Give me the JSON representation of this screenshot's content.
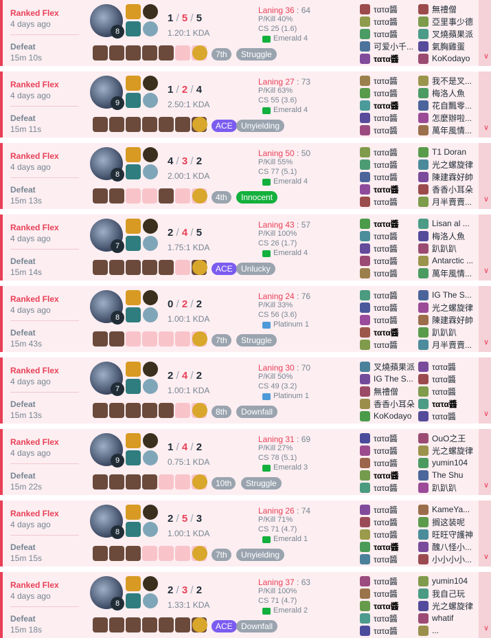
{
  "colors": {
    "loss_accent": "#e84057",
    "muted": "#758592",
    "tag_gray": "#9aa4af",
    "ace": "#7b5cf0",
    "good": "#13b03d",
    "emerald": "#13b03d",
    "platinum": "#4e9ad9"
  },
  "matches": [
    {
      "mode": "Ranked Flex",
      "ago": "4 days ago",
      "result": "Defeat",
      "duration": "15m 10s",
      "level": "8",
      "kda": {
        "k": "1",
        "d": "5",
        "a": "5"
      },
      "ratio": "1.20:1 KDA",
      "position": "7th",
      "position_ace": false,
      "tag": "Struggle",
      "tag_positive": false,
      "laning": "Laning 36",
      "laning_vs": "64",
      "pkill": "P/Kill 40%",
      "cs": "CS 25 (1.6)",
      "tier": "Emerald 4",
      "tier_kind": "emerald",
      "items": [
        "f",
        "f",
        "f",
        "f",
        "f",
        "e",
        "e"
      ],
      "team1": [
        "τατα醬",
        "τατα醬",
        "τατα醬",
        "可爱小千...",
        "τατα醬"
      ],
      "team2": [
        "無禮僧",
        "亞里事少德",
        "叉燒蘋果派",
        "氣胸雞蛋",
        "KoKodayo"
      ],
      "me_side": 1,
      "me_index": 4
    },
    {
      "mode": "Ranked Flex",
      "ago": "4 days ago",
      "result": "Defeat",
      "duration": "15m 11s",
      "level": "9",
      "kda": {
        "k": "1",
        "d": "2",
        "a": "4"
      },
      "ratio": "2.50:1 KDA",
      "position": "ACE",
      "position_ace": true,
      "tag": "Unyielding",
      "tag_positive": false,
      "laning": "Laning 27",
      "laning_vs": "73",
      "pkill": "P/Kill 63%",
      "cs": "CS 55 (3.6)",
      "tier": "Emerald 4",
      "tier_kind": "emerald",
      "items": [
        "f",
        "f",
        "f",
        "f",
        "f",
        "f",
        "f"
      ],
      "team1": [
        "τατα醬",
        "τατα醬",
        "τατα醬",
        "τατα醬",
        "τατα醬"
      ],
      "team2": [
        "我不是叉...",
        "梅洛人魚",
        "花自飄零...",
        "怎麼辦啦...",
        "萬年風情..."
      ],
      "me_side": 1,
      "me_index": 2
    },
    {
      "mode": "Ranked Flex",
      "ago": "4 days ago",
      "result": "Defeat",
      "duration": "15m 13s",
      "level": "8",
      "kda": {
        "k": "4",
        "d": "3",
        "a": "2"
      },
      "ratio": "2.00:1 KDA",
      "position": "4th",
      "position_ace": false,
      "tag": "Innocent",
      "tag_positive": true,
      "laning": "Laning 50",
      "laning_vs": "50",
      "pkill": "P/Kill 55%",
      "cs": "CS 77 (5.1)",
      "tier": "Emerald 4",
      "tier_kind": "emerald",
      "items": [
        "f",
        "f",
        "e",
        "e",
        "f",
        "e",
        "e"
      ],
      "team1": [
        "τατα醬",
        "τατα醬",
        "τατα醬",
        "τατα醬",
        "τατα醬"
      ],
      "team2": [
        "T1 Doran",
        "光之螺旋律",
        "陳建霖好帥",
        "香香小耳朵",
        "月半賣賣..."
      ],
      "me_side": 1,
      "me_index": 3
    },
    {
      "mode": "Ranked Flex",
      "ago": "4 days ago",
      "result": "Defeat",
      "duration": "15m 14s",
      "level": "7",
      "kda": {
        "k": "2",
        "d": "4",
        "a": "5"
      },
      "ratio": "1.75:1 KDA",
      "position": "ACE",
      "position_ace": true,
      "tag": "Unlucky",
      "tag_positive": false,
      "laning": "Laning 43",
      "laning_vs": "57",
      "pkill": "P/Kill 100%",
      "cs": "CS 26 (1.7)",
      "tier": "Emerald 4",
      "tier_kind": "emerald",
      "items": [
        "f",
        "f",
        "f",
        "f",
        "f",
        "e",
        "f"
      ],
      "team1": [
        "τατα醬",
        "τατα醬",
        "τατα醬",
        "τατα醬",
        "τατα醬"
      ],
      "team2": [
        "Lisan al ...",
        "梅洛人魚",
        "趴趴趴",
        "Antarctic ...",
        "萬年風情..."
      ],
      "me_side": 1,
      "me_index": 0
    },
    {
      "mode": "Ranked Flex",
      "ago": "4 days ago",
      "result": "Defeat",
      "duration": "15m 43s",
      "level": "8",
      "kda": {
        "k": "0",
        "d": "2",
        "a": "2"
      },
      "ratio": "1.00:1 KDA",
      "position": "7th",
      "position_ace": false,
      "tag": "Struggle",
      "tag_positive": false,
      "laning": "Laning 24",
      "laning_vs": "76",
      "pkill": "P/Kill 33%",
      "cs": "CS 56 (3.6)",
      "tier": "Platinum 1",
      "tier_kind": "platinum",
      "items": [
        "f",
        "f",
        "e",
        "e",
        "e",
        "e",
        "e"
      ],
      "team1": [
        "τατα醬",
        "τατα醬",
        "τατα醬",
        "τατα醬",
        "τατα醬"
      ],
      "team2": [
        "IG The S...",
        "光之螺旋律",
        "陳建霖好帥",
        "趴趴趴",
        "月半賣賣..."
      ],
      "me_side": 1,
      "me_index": 3
    },
    {
      "mode": "Ranked Flex",
      "ago": "4 days ago",
      "result": "Defeat",
      "duration": "15m 13s",
      "level": "7",
      "kda": {
        "k": "2",
        "d": "4",
        "a": "2"
      },
      "ratio": "1.00:1 KDA",
      "position": "8th",
      "position_ace": false,
      "tag": "Downfall",
      "tag_positive": false,
      "laning": "Laning 30",
      "laning_vs": "70",
      "pkill": "P/Kill 50%",
      "cs": "CS 49 (3.2)",
      "tier": "Platinum 1",
      "tier_kind": "platinum",
      "items": [
        "f",
        "f",
        "f",
        "f",
        "f",
        "e",
        "e"
      ],
      "team1": [
        "叉燒蘋果派",
        "IG The S...",
        "無禮僧",
        "香香小耳朵",
        "KoKodayo"
      ],
      "team2": [
        "τατα醬",
        "τατα醬",
        "τατα醬",
        "τατα醬",
        "τατα醬"
      ],
      "me_side": 2,
      "me_index": 3
    },
    {
      "mode": "Ranked Flex",
      "ago": "4 days ago",
      "result": "Defeat",
      "duration": "15m 22s",
      "level": "9",
      "kda": {
        "k": "1",
        "d": "4",
        "a": "2"
      },
      "ratio": "0.75:1 KDA",
      "position": "10th",
      "position_ace": false,
      "tag": "Struggle",
      "tag_positive": false,
      "laning": "Laning 31",
      "laning_vs": "69",
      "pkill": "P/Kill 27%",
      "cs": "CS 78 (5.1)",
      "tier": "Emerald 3",
      "tier_kind": "emerald",
      "items": [
        "f",
        "f",
        "f",
        "f",
        "e",
        "e",
        "e"
      ],
      "team1": [
        "τατα醬",
        "τατα醬",
        "τατα醬",
        "τατα醬",
        "τατα醬"
      ],
      "team2": [
        "OuO之王",
        "光之螺旋律",
        "yumin104",
        "The Shu",
        "趴趴趴"
      ],
      "me_side": 1,
      "me_index": 3
    },
    {
      "mode": "Ranked Flex",
      "ago": "4 days ago",
      "result": "Defeat",
      "duration": "15m 15s",
      "level": "8",
      "kda": {
        "k": "2",
        "d": "5",
        "a": "3"
      },
      "ratio": "1.00:1 KDA",
      "position": "7th",
      "position_ace": false,
      "tag": "Unyielding",
      "tag_positive": false,
      "laning": "Laning 26",
      "laning_vs": "74",
      "pkill": "P/Kill 71%",
      "cs": "CS 71 (4.7)",
      "tier": "Emerald 1",
      "tier_kind": "emerald",
      "items": [
        "f",
        "f",
        "f",
        "e",
        "e",
        "e",
        "e"
      ],
      "team1": [
        "τατα醬",
        "τατα醬",
        "τατα醬",
        "τατα醬",
        "τατα醬"
      ],
      "team2": [
        "KameYa...",
        "搁这装呢",
        "旺旺守護神",
        "醜八怪小...",
        "小小小小..."
      ],
      "me_side": 1,
      "me_index": 3
    },
    {
      "mode": "Ranked Flex",
      "ago": "4 days ago",
      "result": "Defeat",
      "duration": "15m 18s",
      "level": "8",
      "kda": {
        "k": "2",
        "d": "3",
        "a": "2"
      },
      "ratio": "1.33:1 KDA",
      "position": "ACE",
      "position_ace": true,
      "tag": "Downfall",
      "tag_positive": false,
      "laning": "Laning 37",
      "laning_vs": "63",
      "pkill": "P/Kill 100%",
      "cs": "CS 71 (4.7)",
      "tier": "Emerald 2",
      "tier_kind": "emerald",
      "items": [
        "f",
        "f",
        "f",
        "f",
        "f",
        "f",
        "f"
      ],
      "team1": [
        "τατα醬",
        "τατα醬",
        "τατα醬",
        "τατα醬",
        "τατα醬"
      ],
      "team2": [
        "yumin104",
        "我自己玩",
        "光之螺旋律",
        "whatif",
        "..."
      ],
      "me_side": 1,
      "me_index": 2
    }
  ]
}
